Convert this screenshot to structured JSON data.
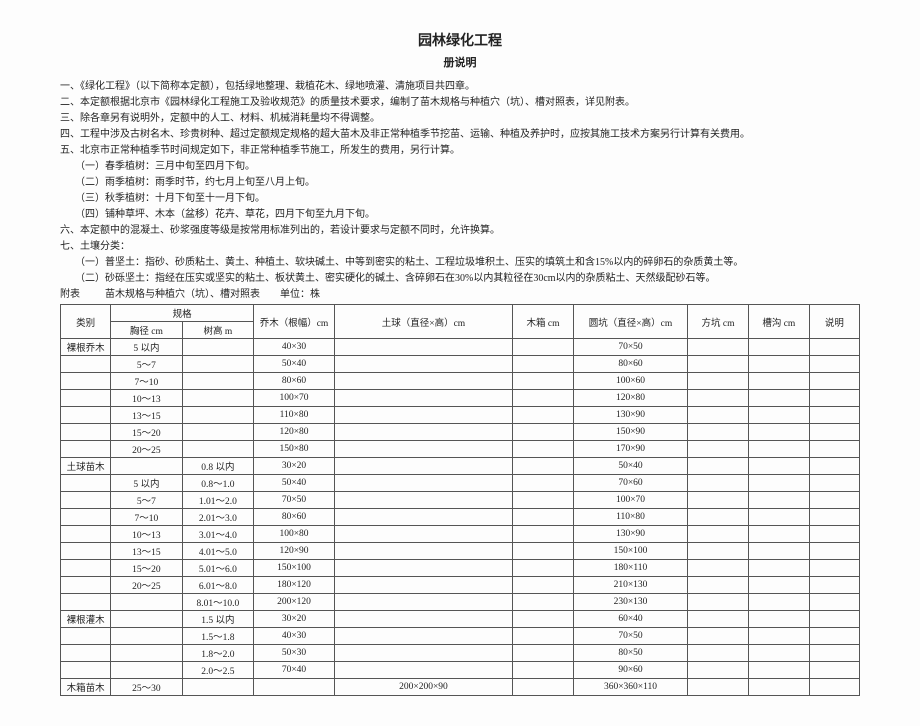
{
  "title": "园林绿化工程",
  "subtitle": "册说明",
  "notes": [
    "一、《绿化工程》（以下简称本定额），包括绿地整理、栽植花木、绿地喷灌、清施项目共四章。",
    "二、本定额根据北京市《园林绿化工程施工及验收规范》的质量技术要求，编制了苗木规格与种植穴（坑）、槽对照表，详见附表。",
    "三、除各章另有说明外，定额中的人工、材料、机械消耗量均不得调整。",
    "四、工程中涉及古树名木、珍贵树种、超过定额规定规格的超大苗木及非正常种植季节挖苗、运输、种植及养护时，应按其施工技术方案另行计算有关费用。",
    "五、北京市正常种植季节时间规定如下，非正常种植季节施工，所发生的费用，另行计算。"
  ],
  "subnotes1": [
    "（一）春季植树：三月中旬至四月下旬。",
    "（二）雨季植树：雨季时节，约七月上旬至八月上旬。",
    "（三）秋季植树：十月下旬至十一月下旬。",
    "（四）铺种草坪、木本（盆移）花卉、草花，四月下旬至九月下旬。"
  ],
  "note6": "六、本定额中的混凝土、砂浆强度等级是按常用标准列出的，若设计要求与定额不同时，允许换算。",
  "note7": "七、土壤分类：",
  "subnotes2": [
    "（一）普坚土：指砂、砂质粘土、黄土、种植土、软块碱土、中等到密实的粘土、工程垃圾堆积土、压实的填筑土和含15%以内的碎卵石的杂质黄土等。",
    "（二）砂砾坚土：指经在压实或坚实的粘土、板状黄土、密实硬化的碱土、含碎卵石在30%以内其粒径在30cm以内的杂质粘土、天然级配砂石等。"
  ],
  "appendix": {
    "label": "附表",
    "title": "苗木规格与种植穴（坑）、槽对照表",
    "unit": "单位：株"
  },
  "headers": {
    "category": "类别",
    "spec": "规格",
    "spec_a": "胸径 cm",
    "spec_b": "树高 m",
    "treecrown": "乔木（根幅）cm",
    "ball": "土球（直径×高）cm",
    "box": "木箱 cm",
    "pit": "圆坑（直径×高）cm",
    "square": "方坑 cm",
    "ditch": "槽沟 cm",
    "note": "说明"
  },
  "rows": [
    {
      "cat": "裸根乔木",
      "a": "5 以内",
      "b": "",
      "crown": "40×30",
      "ball": "",
      "box": "",
      "pit": "70×50",
      "sq": "",
      "ditch": "",
      "note": ""
    },
    {
      "cat": "",
      "a": "5～7",
      "b": "",
      "crown": "50×40",
      "ball": "",
      "box": "",
      "pit": "80×60",
      "sq": "",
      "ditch": "",
      "note": ""
    },
    {
      "cat": "",
      "a": "7～10",
      "b": "",
      "crown": "80×60",
      "ball": "",
      "box": "",
      "pit": "100×60",
      "sq": "",
      "ditch": "",
      "note": ""
    },
    {
      "cat": "",
      "a": "10～13",
      "b": "",
      "crown": "100×70",
      "ball": "",
      "box": "",
      "pit": "120×80",
      "sq": "",
      "ditch": "",
      "note": ""
    },
    {
      "cat": "",
      "a": "13～15",
      "b": "",
      "crown": "110×80",
      "ball": "",
      "box": "",
      "pit": "130×90",
      "sq": "",
      "ditch": "",
      "note": ""
    },
    {
      "cat": "",
      "a": "15～20",
      "b": "",
      "crown": "120×80",
      "ball": "",
      "box": "",
      "pit": "150×90",
      "sq": "",
      "ditch": "",
      "note": ""
    },
    {
      "cat": "",
      "a": "20～25",
      "b": "",
      "crown": "150×80",
      "ball": "",
      "box": "",
      "pit": "170×90",
      "sq": "",
      "ditch": "",
      "note": ""
    },
    {
      "cat": "土球苗木",
      "a": "",
      "b": "0.8 以内",
      "crown": "30×20",
      "ball": "",
      "box": "",
      "pit": "50×40",
      "sq": "",
      "ditch": "",
      "note": ""
    },
    {
      "cat": "",
      "a": "5 以内",
      "b": "0.8～1.0",
      "crown": "50×40",
      "ball": "",
      "box": "",
      "pit": "70×60",
      "sq": "",
      "ditch": "",
      "note": ""
    },
    {
      "cat": "",
      "a": "5～7",
      "b": "1.01～2.0",
      "crown": "70×50",
      "ball": "",
      "box": "",
      "pit": "100×70",
      "sq": "",
      "ditch": "",
      "note": ""
    },
    {
      "cat": "",
      "a": "7～10",
      "b": "2.01～3.0",
      "crown": "80×60",
      "ball": "",
      "box": "",
      "pit": "110×80",
      "sq": "",
      "ditch": "",
      "note": ""
    },
    {
      "cat": "",
      "a": "10～13",
      "b": "3.01～4.0",
      "crown": "100×80",
      "ball": "",
      "box": "",
      "pit": "130×90",
      "sq": "",
      "ditch": "",
      "note": ""
    },
    {
      "cat": "",
      "a": "13～15",
      "b": "4.01～5.0",
      "crown": "120×90",
      "ball": "",
      "box": "",
      "pit": "150×100",
      "sq": "",
      "ditch": "",
      "note": ""
    },
    {
      "cat": "",
      "a": "15～20",
      "b": "5.01～6.0",
      "crown": "150×100",
      "ball": "",
      "box": "",
      "pit": "180×110",
      "sq": "",
      "ditch": "",
      "note": ""
    },
    {
      "cat": "",
      "a": "20～25",
      "b": "6.01～8.0",
      "crown": "180×120",
      "ball": "",
      "box": "",
      "pit": "210×130",
      "sq": "",
      "ditch": "",
      "note": ""
    },
    {
      "cat": "",
      "a": "",
      "b": "8.01～10.0",
      "crown": "200×120",
      "ball": "",
      "box": "",
      "pit": "230×130",
      "sq": "",
      "ditch": "",
      "note": ""
    },
    {
      "cat": "裸根灌木",
      "a": "",
      "b": "1.5 以内",
      "crown": "30×20",
      "ball": "",
      "box": "",
      "pit": "60×40",
      "sq": "",
      "ditch": "",
      "note": ""
    },
    {
      "cat": "",
      "a": "",
      "b": "1.5～1.8",
      "crown": "40×30",
      "ball": "",
      "box": "",
      "pit": "70×50",
      "sq": "",
      "ditch": "",
      "note": ""
    },
    {
      "cat": "",
      "a": "",
      "b": "1.8～2.0",
      "crown": "50×30",
      "ball": "",
      "box": "",
      "pit": "80×50",
      "sq": "",
      "ditch": "",
      "note": ""
    },
    {
      "cat": "",
      "a": "",
      "b": "2.0～2.5",
      "crown": "70×40",
      "ball": "",
      "box": "",
      "pit": "90×60",
      "sq": "",
      "ditch": "",
      "note": ""
    },
    {
      "cat": "木箱苗木",
      "a": "25～30",
      "b": "",
      "crown": "",
      "ball": "200×200×90",
      "box": "",
      "pit": "360×360×110",
      "sq": "",
      "ditch": "",
      "note": ""
    }
  ]
}
